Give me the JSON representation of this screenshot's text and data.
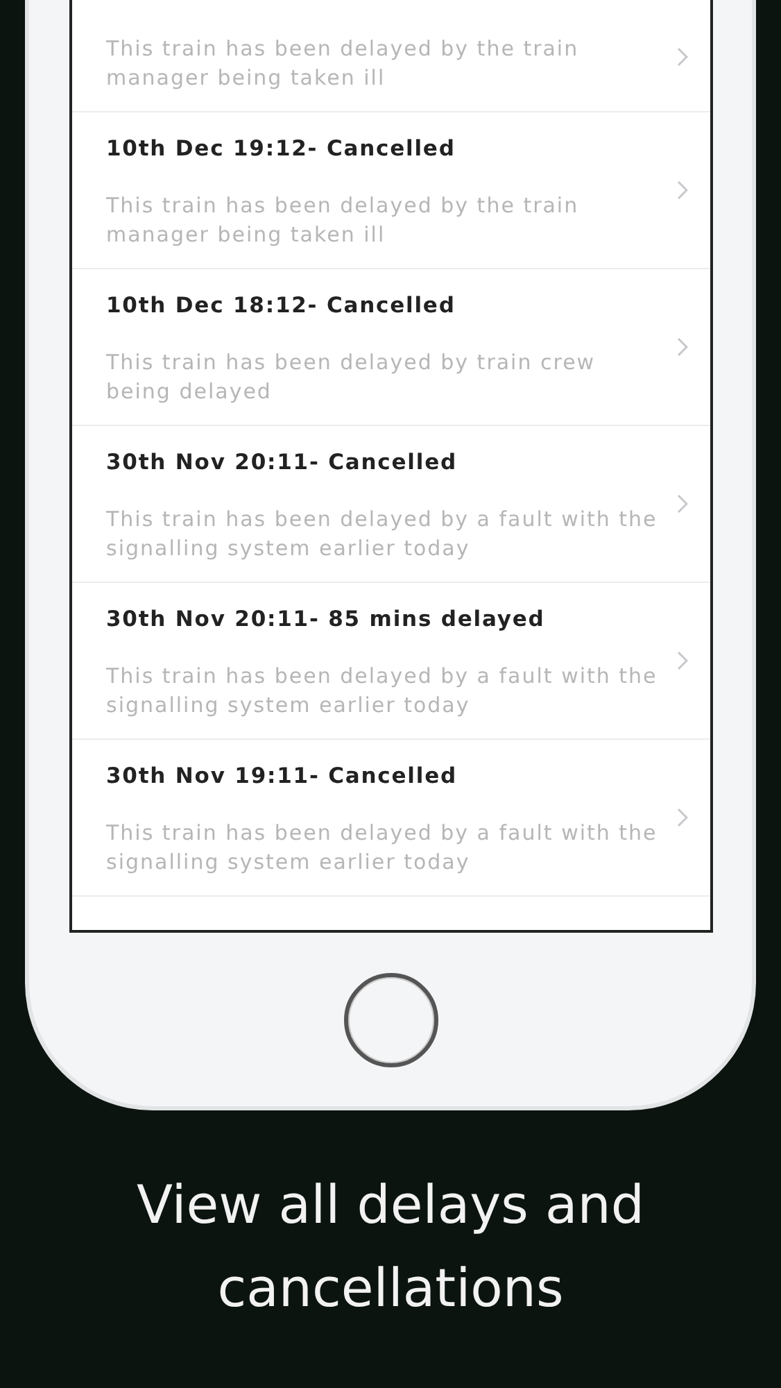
{
  "delays": [
    {
      "description": "This train has been delayed by the train manager being taken ill"
    },
    {
      "title": "10th Dec 19:12- Cancelled",
      "description": "This train has been delayed by the train manager being taken ill"
    },
    {
      "title": "10th Dec 18:12- Cancelled",
      "description": "This train has been delayed by train crew being delayed"
    },
    {
      "title": "30th Nov 20:11- Cancelled",
      "description": "This train has been delayed by a fault with the signalling system earlier today"
    },
    {
      "title": "30th Nov 20:11- 85 mins delayed",
      "description": "This train has been delayed by a fault with the signalling system earlier today"
    },
    {
      "title": "30th Nov 19:11- Cancelled",
      "description": "This train has been delayed by a fault with the signalling system earlier today"
    }
  ],
  "caption": "View all delays and cancellations"
}
